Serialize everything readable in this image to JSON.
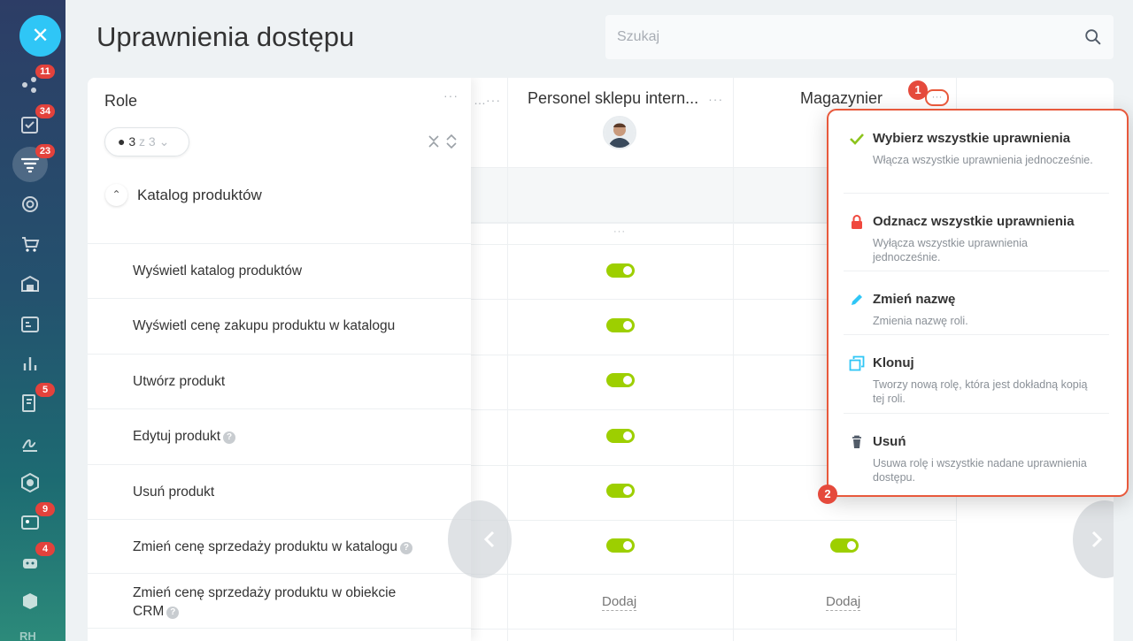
{
  "page": {
    "title": "Uprawnienia dostępu"
  },
  "search": {
    "placeholder": "Szukaj"
  },
  "rail": {
    "badges": {
      "item1": "11",
      "item2": "34",
      "item3": "23",
      "item10": "5",
      "item13": "9",
      "item14": "4"
    },
    "bottom_label": "RH"
  },
  "table": {
    "roles_label": "Role",
    "filter": {
      "count": "3",
      "of_label": "z 3"
    },
    "truncated_column_dots": "...",
    "columns": [
      {
        "title": "Personel sklepu intern..."
      },
      {
        "title": "Magazynier"
      }
    ],
    "section": {
      "label": "Katalog produktów"
    },
    "rows": [
      {
        "label": "Wyświetl katalog produktów"
      },
      {
        "label": "Wyświetl cenę zakupu produktu w katalogu"
      },
      {
        "label": "Utwórz produkt"
      },
      {
        "label": "Edytuj produkt"
      },
      {
        "label": "Usuń produkt"
      },
      {
        "label": "Zmień cenę sprzedaży produktu w katalogu"
      },
      {
        "label": "Zmień cenę sprzedaży produktu w obiekcie CRM"
      }
    ],
    "add_label": "Dodaj",
    "help_glyph": "?"
  },
  "callouts": {
    "one": "1",
    "two": "2"
  },
  "menu": {
    "items": [
      {
        "title": "Wybierz wszystkie uprawnienia",
        "desc": "Włącza wszystkie uprawnienia jednocześnie.",
        "icon": "check-icon",
        "color": "#8dc41d"
      },
      {
        "title": "Odznacz wszystkie uprawnienia",
        "desc": "Wyłącza wszystkie uprawnienia jednocześnie.",
        "icon": "lock-icon",
        "color": "#f0483e"
      },
      {
        "title": "Zmień nazwę",
        "desc": "Zmienia nazwę roli.",
        "icon": "pencil-icon",
        "color": "#2fc6f6"
      },
      {
        "title": "Klonuj",
        "desc": "Tworzy nową rolę, która jest dokładną kopią tej roli.",
        "icon": "clone-icon",
        "color": "#2fc6f6"
      },
      {
        "title": "Usuń",
        "desc": "Usuwa rolę i wszystkie nadane uprawnienia dostępu.",
        "icon": "trash-icon",
        "color": "#525c69"
      }
    ]
  },
  "colors": {
    "accent": "#2fc6f6",
    "toggle_on": "#9dcf00",
    "callout": "#e8593c",
    "badge": "#e3423c"
  }
}
